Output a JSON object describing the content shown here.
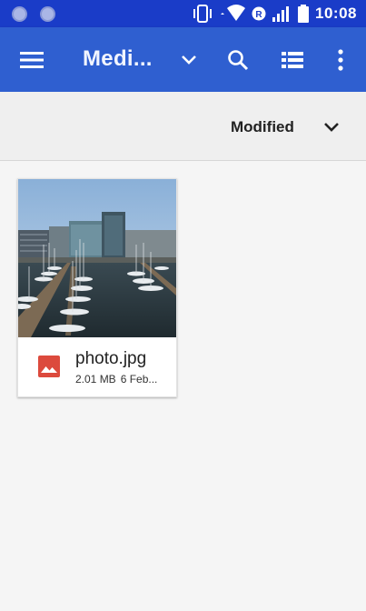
{
  "status_bar": {
    "time": "10:08"
  },
  "app_bar": {
    "title": "Medi..."
  },
  "sort": {
    "label": "Modified"
  },
  "files": [
    {
      "name": "photo.jpg",
      "size": "2.01 MB",
      "date": "6 Feb..."
    }
  ]
}
